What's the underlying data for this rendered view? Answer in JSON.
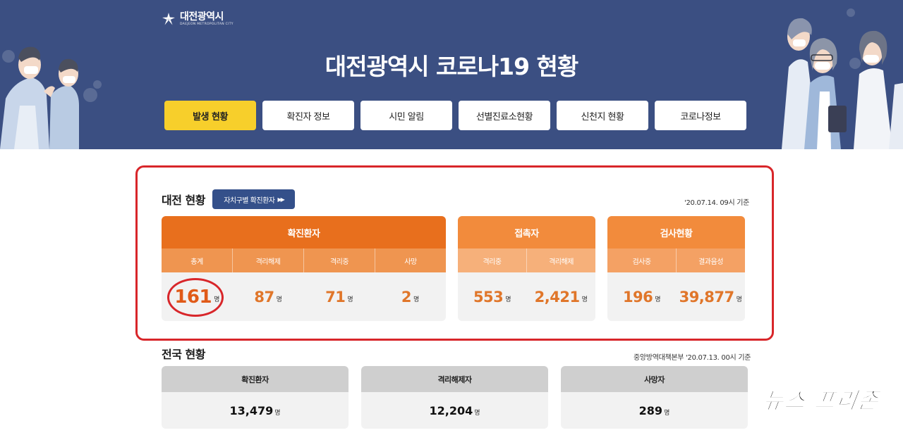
{
  "header": {
    "logo_name": "대전광역시",
    "logo_sub": "DAEJEON METROPOLITAN CITY",
    "title": "대전광역시 코로나19 현황",
    "nav": [
      {
        "label": "발생 현황",
        "active": true
      },
      {
        "label": "확진자 정보",
        "active": false
      },
      {
        "label": "시민 알림",
        "active": false
      },
      {
        "label": "선별진료소현황",
        "active": false
      },
      {
        "label": "신천지 현황",
        "active": false
      },
      {
        "label": "코로나정보",
        "active": false
      }
    ]
  },
  "daejeon": {
    "title": "대전 현황",
    "district_button": "자치구별 확진환자",
    "stamp": "'20.07.14. 09시 기준",
    "unit": "명",
    "confirmed": {
      "title": "확진환자",
      "cols": [
        {
          "label": "총계",
          "value": "161"
        },
        {
          "label": "격리해제",
          "value": "87"
        },
        {
          "label": "격리중",
          "value": "71"
        },
        {
          "label": "사망",
          "value": "2"
        }
      ]
    },
    "contacts": {
      "title": "접촉자",
      "cols": [
        {
          "label": "격리중",
          "value": "553"
        },
        {
          "label": "격리해제",
          "value": "2,421"
        }
      ]
    },
    "tests": {
      "title": "검사현황",
      "cols": [
        {
          "label": "검사중",
          "value": "196"
        },
        {
          "label": "결과음성",
          "value": "39,877"
        }
      ]
    }
  },
  "national": {
    "title": "전국 현황",
    "stamp": "중앙방역대책본부 '20.07.13. 00시 기준",
    "unit": "명",
    "cards": [
      {
        "label": "확진환자",
        "value": "13,479"
      },
      {
        "label": "격리해제자",
        "value": "12,204"
      },
      {
        "label": "사망자",
        "value": "289"
      }
    ]
  },
  "watermark": "뉴스 프리존",
  "colors": {
    "header_bg": "#3b4f82",
    "active_tab": "#f7cf2b",
    "orange": "#e86f1d",
    "highlight_red": "#d8262a"
  }
}
